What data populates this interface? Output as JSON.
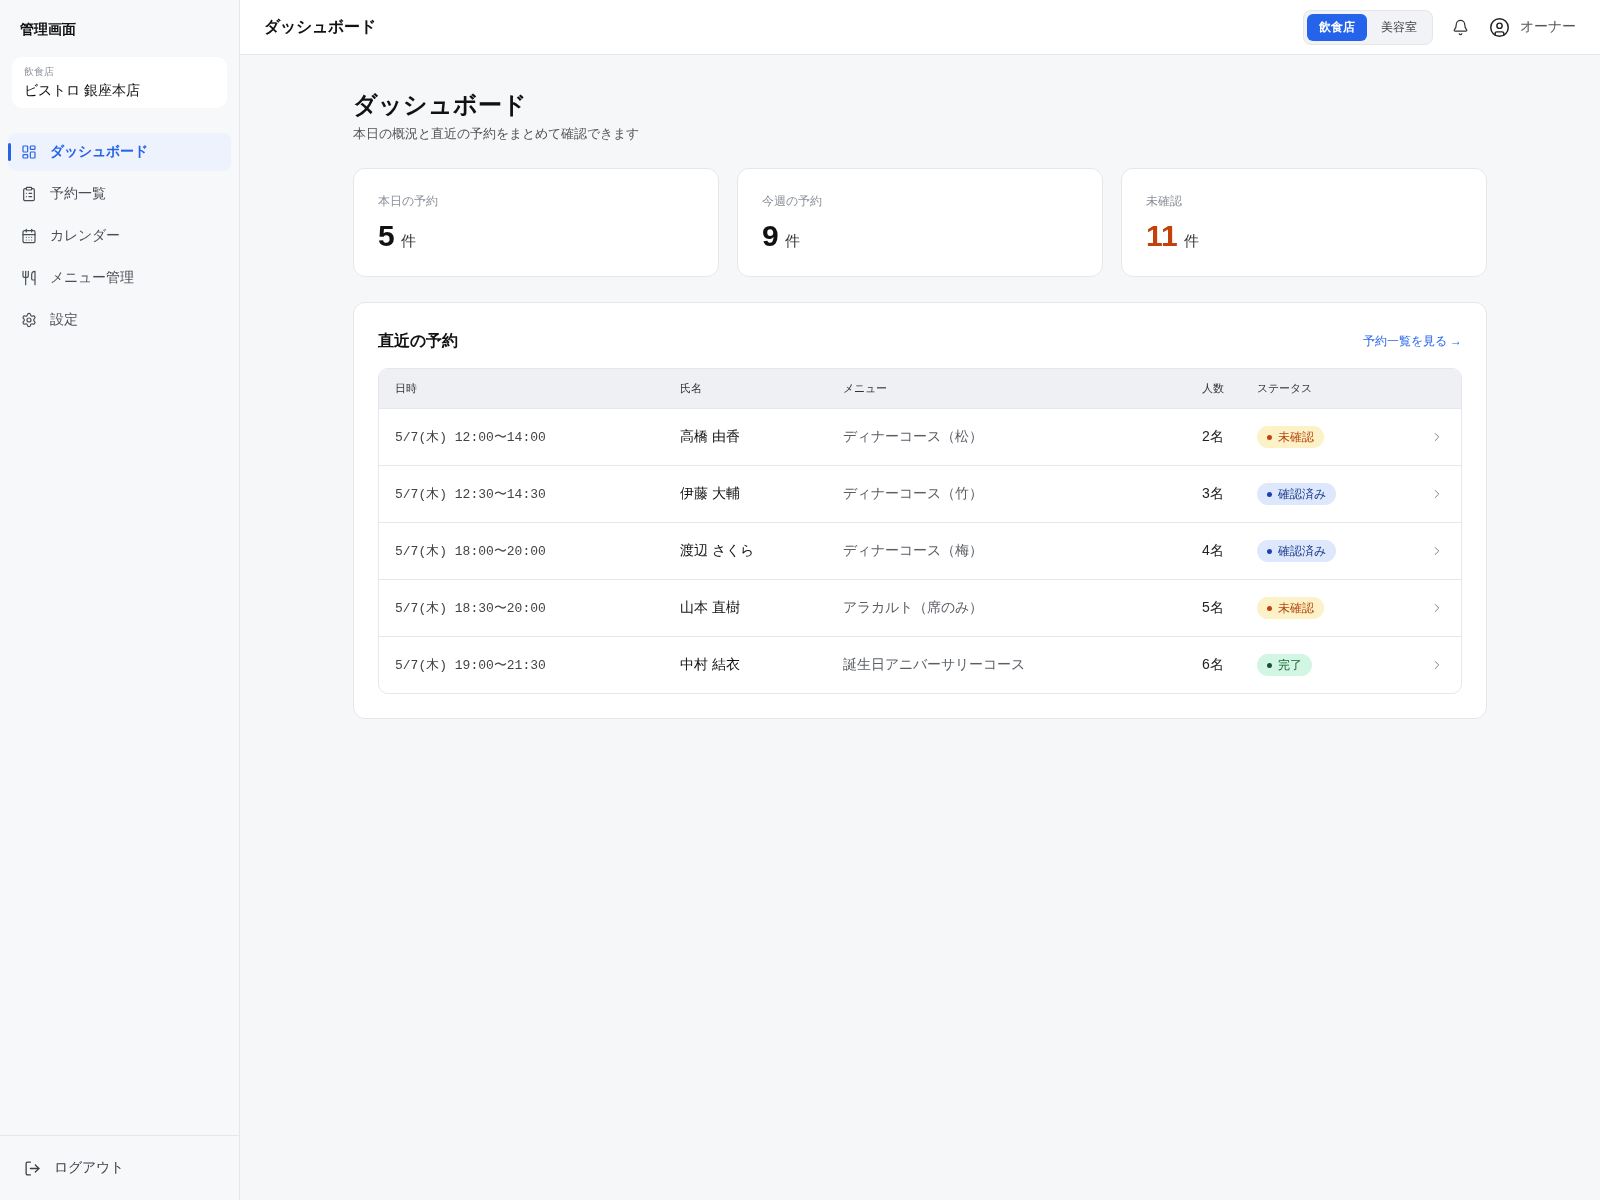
{
  "sidebar": {
    "title": "管理画面",
    "store": {
      "type": "飲食店",
      "name": "ビストロ 銀座本店"
    },
    "nav": [
      {
        "label": "ダッシュボード",
        "selected": true
      },
      {
        "label": "予約一覧",
        "selected": false
      },
      {
        "label": "カレンダー",
        "selected": false
      },
      {
        "label": "メニュー管理",
        "selected": false
      },
      {
        "label": "設定",
        "selected": false
      }
    ],
    "logout": "ログアウト"
  },
  "header": {
    "title": "ダッシュボード",
    "business_toggle": [
      {
        "label": "飲食店",
        "selected": true
      },
      {
        "label": "美容室",
        "selected": false
      }
    ],
    "user": "オーナー"
  },
  "page": {
    "title": "ダッシュボード",
    "subtitle": "本日の概況と直近の予約をまとめて確認できます"
  },
  "stats": [
    {
      "label": "本日の予約",
      "value": "5",
      "unit": "件",
      "alert": false
    },
    {
      "label": "今週の予約",
      "value": "9",
      "unit": "件",
      "alert": false
    },
    {
      "label": "未確認",
      "value": "11",
      "unit": "件",
      "alert": true
    }
  ],
  "recent": {
    "title": "直近の予約",
    "link": "予約一覧を見る →",
    "columns": [
      "日時",
      "氏名",
      "メニュー",
      "人数",
      "ステータス"
    ],
    "rows": [
      {
        "datetime": "5/7(木) 12:00〜14:00",
        "name": "高橋 由香",
        "menu": "ディナーコース（松）",
        "party": "2名",
        "status": {
          "label": "未確認",
          "kind": "pending"
        }
      },
      {
        "datetime": "5/7(木) 12:30〜14:30",
        "name": "伊藤 大輔",
        "menu": "ディナーコース（竹）",
        "party": "3名",
        "status": {
          "label": "確認済み",
          "kind": "confirmed"
        }
      },
      {
        "datetime": "5/7(木) 18:00〜20:00",
        "name": "渡辺 さくら",
        "menu": "ディナーコース（梅）",
        "party": "4名",
        "status": {
          "label": "確認済み",
          "kind": "confirmed"
        }
      },
      {
        "datetime": "5/7(木) 18:30〜20:00",
        "name": "山本 直樹",
        "menu": "アラカルト（席のみ）",
        "party": "5名",
        "status": {
          "label": "未確認",
          "kind": "pending"
        }
      },
      {
        "datetime": "5/7(木) 19:00〜21:30",
        "name": "中村 結衣",
        "menu": "誕生日アニバーサリーコース",
        "party": "6名",
        "status": {
          "label": "完了",
          "kind": "done"
        }
      }
    ]
  }
}
